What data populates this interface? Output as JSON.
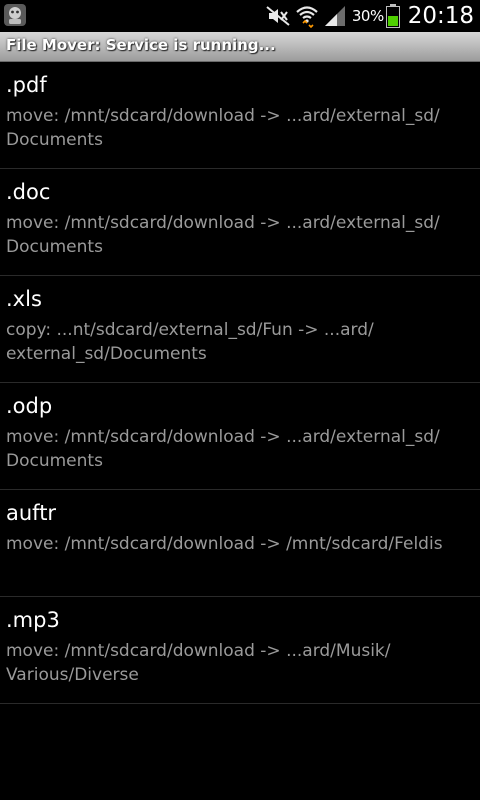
{
  "status_bar": {
    "battery_percent": "30%",
    "time": "20:18",
    "icons": [
      "app-robot-icon",
      "mute-icon",
      "wifi-icon",
      "signal-icon",
      "battery-icon"
    ],
    "battery_color": "#4fd000"
  },
  "notification": {
    "text": "File Mover: Service is running..."
  },
  "rules": [
    {
      "title": ".pdf",
      "desc_line1": "move: /mnt/sdcard/download -> ...ard/external_sd/",
      "desc_line2": "Documents"
    },
    {
      "title": ".doc",
      "desc_line1": "move: /mnt/sdcard/download -> ...ard/external_sd/",
      "desc_line2": "Documents"
    },
    {
      "title": ".xls",
      "desc_line1": "copy: ...nt/sdcard/external_sd/Fun -> ...ard/",
      "desc_line2": "external_sd/Documents"
    },
    {
      "title": ".odp",
      "desc_line1": "move: /mnt/sdcard/download -> ...ard/external_sd/",
      "desc_line2": "Documents"
    },
    {
      "title": "auftr",
      "desc_line1": "move: /mnt/sdcard/download -> /mnt/sdcard/Feldis",
      "desc_line2": ""
    },
    {
      "title": ".mp3",
      "desc_line1": "move: /mnt/sdcard/download -> ...ard/Musik/",
      "desc_line2": "Various/Diverse"
    }
  ]
}
